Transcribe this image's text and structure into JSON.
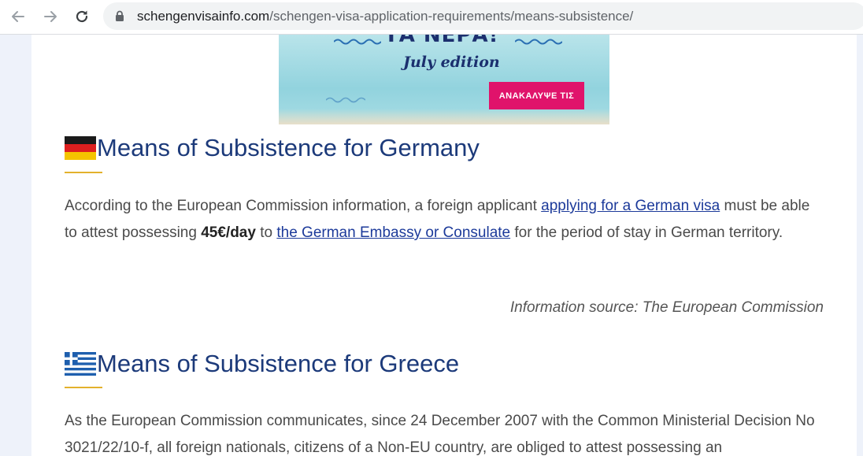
{
  "browser": {
    "url_host": "schengenvisainfo.com",
    "url_path": "/schengen-visa-application-requirements/means-subsistence/"
  },
  "ad": {
    "title": "ΤΑ ΝΕΡΑ!",
    "subtitle": "July edition",
    "cta": "ΑΝΑΚΑΛΥΨΕ ΤΙΣ"
  },
  "germany": {
    "heading": "Means of Subsistence for Germany",
    "text_1": "According to the European Commission information, a foreign applicant ",
    "link_1": "applying for a German visa",
    "text_2": " must be able to attest possessing ",
    "amount": "45€/day",
    "text_3": " to ",
    "link_2": "the German Embassy or Consulate",
    "text_4": " for the period of stay in German territory.",
    "source": "Information source: The European Commission"
  },
  "greece": {
    "heading": "Means of Subsistence for Greece",
    "text": "As the European Commission communicates, since 24 December 2007 with the Common Ministerial Decision No 3021/22/10-f, all foreign nationals, citizens of a Non-EU country, are obliged to attest possessing an"
  },
  "colors": {
    "heading": "#1c3a7a",
    "link": "#1c3a9a",
    "accent_underline": "#e3b12c",
    "ad_cta": "#e0136b"
  },
  "icons": [
    "back-arrow-icon",
    "forward-arrow-icon",
    "reload-icon",
    "lock-icon",
    "germany-flag-icon",
    "greece-flag-icon"
  ]
}
